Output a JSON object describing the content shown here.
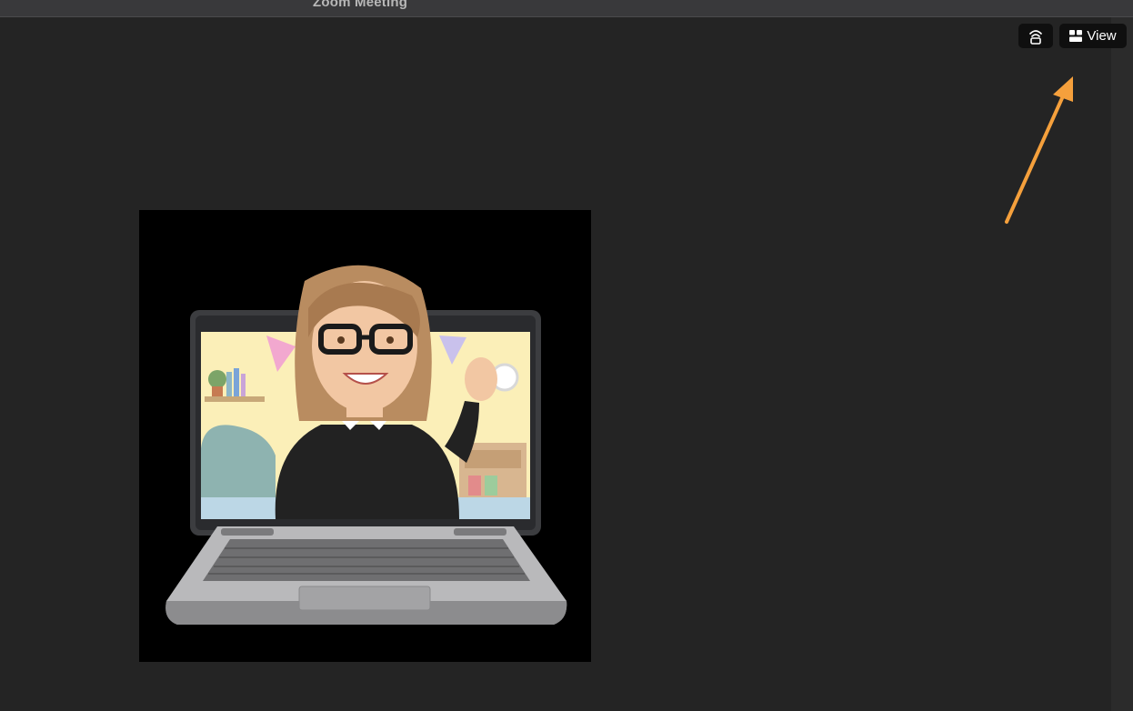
{
  "window": {
    "title": "Zoom Meeting"
  },
  "controls": {
    "immersive_icon": "immersive-view-icon",
    "view_icon": "grid-view-icon",
    "view_label": "View"
  },
  "participant": {
    "avatar_description_icon": "bitmoji-avatar-on-laptop"
  },
  "colors": {
    "background": "#242424",
    "titlebar": "#39393b",
    "button_bg": "#0f0f0f",
    "annotation_arrow": "#f5a03c"
  }
}
